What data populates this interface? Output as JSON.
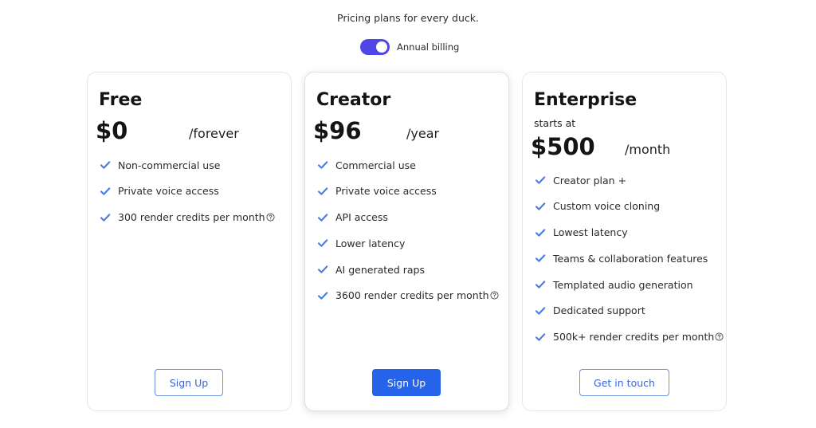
{
  "header": {
    "subtitle": "Pricing plans for every duck.",
    "billing_label": "Annual billing",
    "annual_billing_on": true
  },
  "colors": {
    "accent": "#4f46e5",
    "check": "#4a7be3",
    "button_primary": "#2563eb",
    "button_outline_text": "#3b63d6"
  },
  "plans": {
    "free": {
      "name": "Free",
      "price": "$0",
      "period": "/forever",
      "features": [
        "Non-commercial use",
        "Private voice access",
        "300 render credits per month"
      ],
      "button": "Sign Up"
    },
    "creator": {
      "name": "Creator",
      "price": "$96",
      "period": "/year",
      "features": [
        "Commercial use",
        "Private voice access",
        "API access",
        "Lower latency",
        "AI generated raps",
        "3600 render credits per month"
      ],
      "button": "Sign Up"
    },
    "enterprise": {
      "name": "Enterprise",
      "prefix": "starts at",
      "price": "$500",
      "period": "/month",
      "features": [
        "Creator plan +",
        "Custom voice cloning",
        "Lowest latency",
        "Teams & collaboration features",
        "Templated audio generation",
        "Dedicated support",
        "500k+ render credits per month"
      ],
      "button": "Get in touch"
    }
  }
}
